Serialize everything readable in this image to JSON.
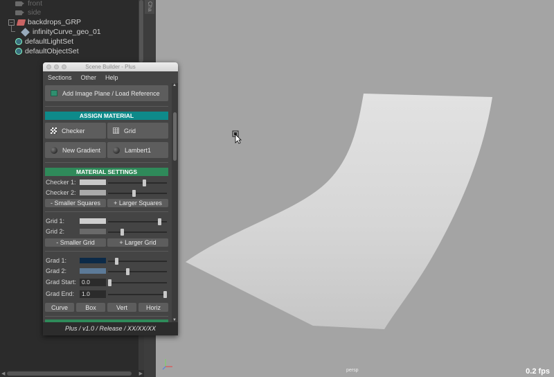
{
  "outliner": {
    "items": [
      {
        "label": "front"
      },
      {
        "label": "side"
      },
      {
        "label": "backdrops_GRP"
      },
      {
        "label": "infinityCurve_geo_01"
      },
      {
        "label": "defaultLightSet"
      },
      {
        "label": "defaultObjectSet"
      }
    ],
    "toggle": "−"
  },
  "channel_tab": "Cha",
  "viewport": {
    "camera": "persp",
    "fps": "0.2 fps",
    "colors": {
      "background": "#a4a4a4"
    }
  },
  "scene_builder": {
    "title": "Scene Builder - Plus",
    "menu": [
      "Sections",
      "Other",
      "Help"
    ],
    "load_button": "Add Image Plane / Load Reference",
    "assign_material": {
      "header": "ASSIGN MATERIAL",
      "color": "#0e8a8a",
      "buttons": [
        "Checker",
        "Grid",
        "New Gradient",
        "Lambert1"
      ]
    },
    "material_settings": {
      "header": "MATERIAL SETTINGS",
      "color": "#2f8a5a",
      "checker1": {
        "label": "Checker 1:",
        "color": "#c9c9c9",
        "slider": 0.62
      },
      "checker2": {
        "label": "Checker 2:",
        "color": "#aaaaaa",
        "slider": 0.44
      },
      "checker_buttons": [
        "- Smaller Squares",
        "+ Larger Squares"
      ],
      "grid1": {
        "label": "Grid 1:",
        "color": "#cfcfcf",
        "slider": 0.9
      },
      "grid2": {
        "label": "Grid 2:",
        "color": "#6a6a6a",
        "slider": 0.23
      },
      "grid_buttons": [
        "- Smaller Grid",
        "+ Larger Grid"
      ],
      "grad1": {
        "label": "Grad 1:",
        "color": "#0c2a48",
        "slider": 0.12
      },
      "grad2": {
        "label": "Grad 2:",
        "color": "#5c7a98",
        "slider": 0.33
      },
      "grad_start": {
        "label": "Grad Start:",
        "value": "0.0",
        "slider": 0.0
      },
      "grad_end": {
        "label": "Grad End:",
        "value": "1.0",
        "slider": 1.0
      },
      "grad_buttons": [
        "Curve",
        "Box",
        "Vert",
        "Horiz"
      ]
    },
    "footer": "Plus  /  v1.0  /  Release  /  XX/XX/XX"
  }
}
